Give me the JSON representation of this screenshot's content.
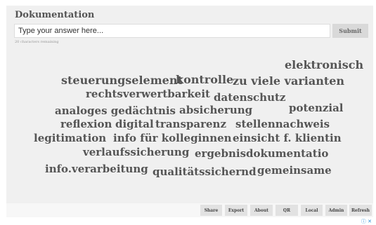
{
  "form": {
    "title": "Dokumentation",
    "input_placeholder": "Type your answer here...",
    "submit_label": "Submit",
    "chars_remaining": "20 characters remaining"
  },
  "wordcloud": {
    "words": [
      "elektronisch",
      "steuerungselement",
      "kontrolle",
      "zu viele varianten",
      "rechtsverwertbarkeit",
      "datenschutz",
      "analoges gedächtnis",
      "absicherung",
      "potenzial",
      "reflexion",
      "digital",
      "transparenz",
      "stellennachweis",
      "legitimation",
      "info für kolleginnen",
      "einsicht f. klientin",
      "verlaufssicherung",
      "ergebnisdokumentatio",
      "info.verarbeitung",
      "qualitätssichernd",
      "gemeinsame"
    ]
  },
  "footer": {
    "buttons": [
      "Share",
      "Export",
      "About",
      "QR",
      "Local",
      "Admin",
      "Refresh"
    ]
  },
  "ad": {
    "info_icon": "info-icon",
    "close_icon": "close-icon"
  }
}
